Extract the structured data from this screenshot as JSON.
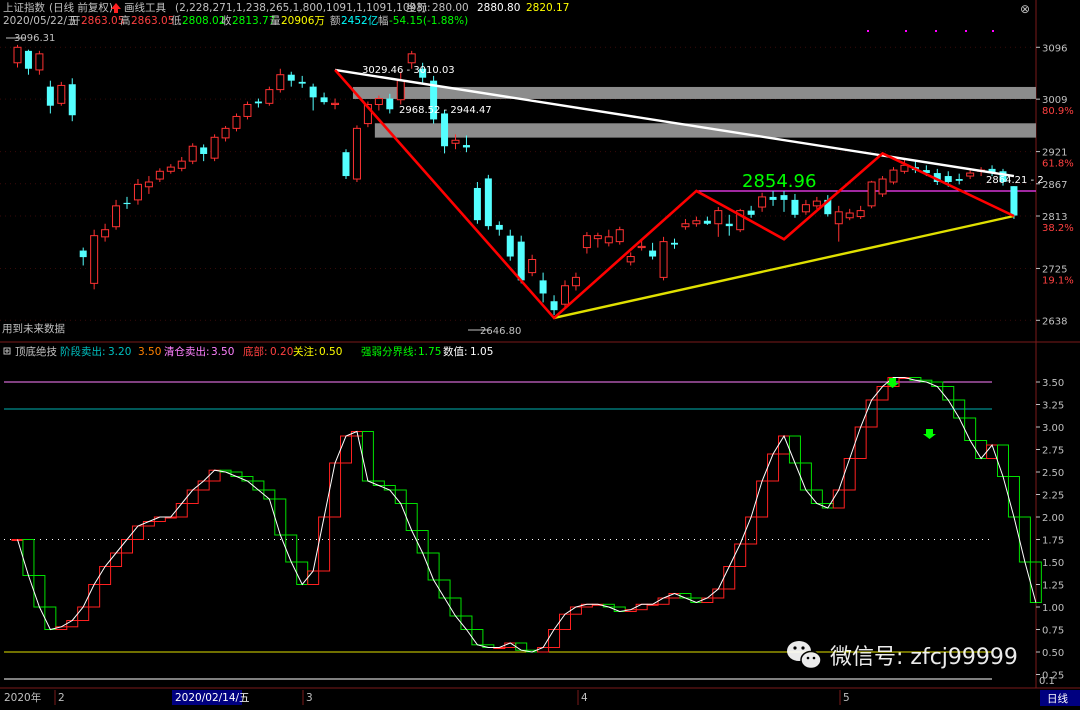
{
  "header": {
    "line1": {
      "index_name": "上证指数",
      "mode": "(日线 前复权)",
      "tool_icon": "up-arrow-icon",
      "tool_label": "画线工具",
      "tool_params": "(2,228,271,1,238,265,1,800,1091,1,1091,1093)",
      "coord_label": "坐标:",
      "coord_val": "280.00",
      "coord_val2": "2880.80",
      "coord_val3": "2820.17"
    },
    "line2": {
      "date": "2020/05/22/五",
      "open_label": "开",
      "open": "2863.05",
      "high_label": "高",
      "high": "2863.05",
      "low_label": "低",
      "low": "2808.02",
      "close_label": "收",
      "close": "2813.77",
      "vol_label": "量",
      "vol": "20906万",
      "amt_label": "额",
      "amt": "2452亿",
      "chg_label": "幅",
      "chg": "-54.15(-1.88%)"
    }
  },
  "price_axis": {
    "ticks": [
      {
        "value": "3096",
        "pct": ""
      },
      {
        "value": "3009",
        "pct": "80.9%"
      },
      {
        "value": "2921",
        "pct": "61.8%"
      },
      {
        "value": "2867",
        "pct": ""
      },
      {
        "value": "2813",
        "pct": "38.2%"
      },
      {
        "value": "2725",
        "pct": "19.1%"
      },
      {
        "value": "2638",
        "pct": ""
      }
    ]
  },
  "annotations": {
    "high_label": "3096.31",
    "zone1_label": "3029.46 - 3010.03",
    "zone2_label": "2968.52 - 2944.47",
    "low_label": "2646.80",
    "peak_label": "2854.96",
    "right_label": "2864.21 - 2",
    "future_note": "用到未来数据"
  },
  "indicator": {
    "name": "顶底绝技",
    "params": [
      {
        "label": "阶段卖出:",
        "value": "3.20",
        "extra": "3.50",
        "color": "#00c0c0"
      },
      {
        "label": "清仓卖出:",
        "value": "3.50",
        "extra": "",
        "color": "#ff80ff"
      },
      {
        "label": "底部:",
        "value": "0.20",
        "extra": "",
        "color": "#ff4040"
      },
      {
        "label": "关注:",
        "value": "0.50",
        "extra": "",
        "color": "#ffff00"
      },
      {
        "label": "强弱分界线:",
        "value": "1.75",
        "extra": "",
        "color": "#00ff00"
      },
      {
        "label": "数值:",
        "value": "1.05",
        "extra": "",
        "color": "#ffffff"
      }
    ],
    "axis_ticks": [
      "3.50",
      "3.25",
      "3.00",
      "2.75",
      "2.50",
      "2.25",
      "2.00",
      "1.75",
      "1.50",
      "1.25",
      "1.00",
      "0.75",
      "0.50",
      "0.25"
    ],
    "corner_value": "0.1"
  },
  "bottom_bar": {
    "year": "2020年",
    "month2": "2",
    "date_highlight": "2020/02/14/五",
    "month3": "3",
    "month4": "4",
    "month5": "5",
    "period": "日线"
  },
  "watermark": {
    "icon": "wechat-icon",
    "text": "微信号: zfcj99999"
  },
  "chart_data": [
    {
      "type": "candlestick",
      "title": "上证指数 日线",
      "ylim": [
        2610,
        3125
      ],
      "y_ticks": [
        3096,
        3009,
        2921,
        2867,
        2813,
        2725,
        2638
      ],
      "fib_levels": {
        "80.9%": 3009,
        "61.8%": 2921,
        "38.2%": 2813,
        "19.1%": 2725
      },
      "candles": [
        {
          "o": 3070,
          "c": 3096,
          "h": 3100,
          "l": 3062
        },
        {
          "o": 3090,
          "c": 3060,
          "h": 3092,
          "l": 3050
        },
        {
          "o": 3058,
          "c": 3085,
          "h": 3090,
          "l": 3050
        },
        {
          "o": 3030,
          "c": 2998,
          "h": 3040,
          "l": 2985
        },
        {
          "o": 3002,
          "c": 3032,
          "h": 3038,
          "l": 2998
        },
        {
          "o": 3034,
          "c": 2982,
          "h": 3044,
          "l": 2972
        },
        {
          "o": 2755,
          "c": 2744,
          "h": 2760,
          "l": 2730
        },
        {
          "o": 2700,
          "c": 2780,
          "h": 2790,
          "l": 2690
        },
        {
          "o": 2778,
          "c": 2790,
          "h": 2800,
          "l": 2770
        },
        {
          "o": 2795,
          "c": 2830,
          "h": 2840,
          "l": 2790
        },
        {
          "o": 2835,
          "c": 2833,
          "h": 2845,
          "l": 2825
        },
        {
          "o": 2840,
          "c": 2866,
          "h": 2875,
          "l": 2832
        },
        {
          "o": 2862,
          "c": 2870,
          "h": 2880,
          "l": 2850
        },
        {
          "o": 2875,
          "c": 2888,
          "h": 2893,
          "l": 2870
        },
        {
          "o": 2888,
          "c": 2895,
          "h": 2900,
          "l": 2884
        },
        {
          "o": 2893,
          "c": 2905,
          "h": 2912,
          "l": 2888
        },
        {
          "o": 2905,
          "c": 2930,
          "h": 2935,
          "l": 2900
        },
        {
          "o": 2928,
          "c": 2917,
          "h": 2933,
          "l": 2905
        },
        {
          "o": 2910,
          "c": 2945,
          "h": 2950,
          "l": 2905
        },
        {
          "o": 2944,
          "c": 2960,
          "h": 2964,
          "l": 2938
        },
        {
          "o": 2960,
          "c": 2980,
          "h": 2985,
          "l": 2955
        },
        {
          "o": 2980,
          "c": 3000,
          "h": 3005,
          "l": 2975
        },
        {
          "o": 3005,
          "c": 3002,
          "h": 3010,
          "l": 2995
        },
        {
          "o": 3002,
          "c": 3025,
          "h": 3030,
          "l": 2998
        },
        {
          "o": 3025,
          "c": 3050,
          "h": 3060,
          "l": 3020
        },
        {
          "o": 3050,
          "c": 3040,
          "h": 3055,
          "l": 3030
        },
        {
          "o": 3038,
          "c": 3035,
          "h": 3048,
          "l": 3028
        },
        {
          "o": 3030,
          "c": 3012,
          "h": 3035,
          "l": 2990
        },
        {
          "o": 3012,
          "c": 3004,
          "h": 3020,
          "l": 3000
        },
        {
          "o": 3000,
          "c": 3002,
          "h": 3010,
          "l": 2992
        },
        {
          "o": 2920,
          "c": 2880,
          "h": 2925,
          "l": 2875
        },
        {
          "o": 2875,
          "c": 2960,
          "h": 2965,
          "l": 2870
        },
        {
          "o": 2968,
          "c": 3000,
          "h": 3005,
          "l": 2962
        },
        {
          "o": 3000,
          "c": 3010,
          "h": 3015,
          "l": 2990
        },
        {
          "o": 3010,
          "c": 2992,
          "h": 3018,
          "l": 2985
        },
        {
          "o": 3008,
          "c": 3040,
          "h": 3055,
          "l": 3000
        },
        {
          "o": 3070,
          "c": 3085,
          "h": 3090,
          "l": 3060
        },
        {
          "o": 3060,
          "c": 3045,
          "h": 3070,
          "l": 3035
        },
        {
          "o": 3040,
          "c": 2975,
          "h": 3048,
          "l": 2968
        },
        {
          "o": 2985,
          "c": 2930,
          "h": 2990,
          "l": 2918
        },
        {
          "o": 2935,
          "c": 2940,
          "h": 2950,
          "l": 2925
        },
        {
          "o": 2932,
          "c": 2928,
          "h": 2948,
          "l": 2920
        },
        {
          "o": 2860,
          "c": 2806,
          "h": 2870,
          "l": 2800
        },
        {
          "o": 2876,
          "c": 2796,
          "h": 2882,
          "l": 2790
        },
        {
          "o": 2798,
          "c": 2790,
          "h": 2804,
          "l": 2780
        },
        {
          "o": 2780,
          "c": 2745,
          "h": 2790,
          "l": 2738
        },
        {
          "o": 2770,
          "c": 2705,
          "h": 2780,
          "l": 2700
        },
        {
          "o": 2718,
          "c": 2740,
          "h": 2748,
          "l": 2712
        },
        {
          "o": 2705,
          "c": 2683,
          "h": 2718,
          "l": 2668
        },
        {
          "o": 2670,
          "c": 2655,
          "h": 2680,
          "l": 2646.8
        },
        {
          "o": 2665,
          "c": 2696,
          "h": 2705,
          "l": 2660
        },
        {
          "o": 2696,
          "c": 2710,
          "h": 2718,
          "l": 2688
        },
        {
          "o": 2760,
          "c": 2780,
          "h": 2786,
          "l": 2750
        },
        {
          "o": 2775,
          "c": 2780,
          "h": 2785,
          "l": 2760
        },
        {
          "o": 2768,
          "c": 2778,
          "h": 2790,
          "l": 2762
        },
        {
          "o": 2770,
          "c": 2790,
          "h": 2795,
          "l": 2765
        },
        {
          "o": 2736,
          "c": 2745,
          "h": 2752,
          "l": 2730
        },
        {
          "o": 2760,
          "c": 2762,
          "h": 2772,
          "l": 2755
        },
        {
          "o": 2755,
          "c": 2745,
          "h": 2768,
          "l": 2740
        },
        {
          "o": 2710,
          "c": 2770,
          "h": 2778,
          "l": 2705
        },
        {
          "o": 2768,
          "c": 2765,
          "h": 2775,
          "l": 2758
        },
        {
          "o": 2795,
          "c": 2800,
          "h": 2808,
          "l": 2790
        },
        {
          "o": 2800,
          "c": 2805,
          "h": 2812,
          "l": 2795
        },
        {
          "o": 2805,
          "c": 2800,
          "h": 2812,
          "l": 2798
        },
        {
          "o": 2800,
          "c": 2822,
          "h": 2828,
          "l": 2778
        },
        {
          "o": 2800,
          "c": 2796,
          "h": 2815,
          "l": 2780
        },
        {
          "o": 2790,
          "c": 2822,
          "h": 2825,
          "l": 2786
        },
        {
          "o": 2822,
          "c": 2815,
          "h": 2830,
          "l": 2810
        },
        {
          "o": 2828,
          "c": 2845,
          "h": 2852,
          "l": 2820
        },
        {
          "o": 2845,
          "c": 2840,
          "h": 2855,
          "l": 2830
        },
        {
          "o": 2848,
          "c": 2840,
          "h": 2855,
          "l": 2820
        },
        {
          "o": 2840,
          "c": 2815,
          "h": 2850,
          "l": 2810
        },
        {
          "o": 2820,
          "c": 2832,
          "h": 2840,
          "l": 2815
        },
        {
          "o": 2830,
          "c": 2838,
          "h": 2845,
          "l": 2825
        },
        {
          "o": 2840,
          "c": 2816,
          "h": 2848,
          "l": 2812
        },
        {
          "o": 2800,
          "c": 2820,
          "h": 2830,
          "l": 2770
        },
        {
          "o": 2810,
          "c": 2818,
          "h": 2825,
          "l": 2806
        },
        {
          "o": 2812,
          "c": 2822,
          "h": 2830,
          "l": 2808
        },
        {
          "o": 2830,
          "c": 2870,
          "h": 2872,
          "l": 2826
        },
        {
          "o": 2850,
          "c": 2875,
          "h": 2880,
          "l": 2845
        },
        {
          "o": 2870,
          "c": 2890,
          "h": 2895,
          "l": 2866
        },
        {
          "o": 2888,
          "c": 2898,
          "h": 2910,
          "l": 2884
        },
        {
          "o": 2895,
          "c": 2890,
          "h": 2905,
          "l": 2885
        },
        {
          "o": 2890,
          "c": 2885,
          "h": 2898,
          "l": 2880
        },
        {
          "o": 2885,
          "c": 2870,
          "h": 2892,
          "l": 2865
        },
        {
          "o": 2880,
          "c": 2870,
          "h": 2888,
          "l": 2862
        },
        {
          "o": 2875,
          "c": 2872,
          "h": 2884,
          "l": 2866
        },
        {
          "o": 2880,
          "c": 2885,
          "h": 2892,
          "l": 2875
        },
        {
          "o": 2888,
          "c": 2890,
          "h": 2895,
          "l": 2880
        },
        {
          "o": 2892,
          "c": 2885,
          "h": 2898,
          "l": 2880
        },
        {
          "o": 2888,
          "c": 2870,
          "h": 2892,
          "l": 2864
        },
        {
          "o": 2863.05,
          "c": 2813.77,
          "h": 2863.05,
          "l": 2808.02
        }
      ],
      "trend_lines": [
        {
          "name": "白色下降趋势线",
          "color": "#ffffff",
          "from": {
            "i": 29,
            "v": 3058
          },
          "to": {
            "i": 91,
            "v": 2880
          }
        },
        {
          "name": "黄色上升趋势线",
          "color": "#e0e000",
          "from": {
            "i": 49,
            "v": 2642
          },
          "to": {
            "i": 91,
            "v": 2813
          }
        },
        {
          "name": "红色走势折线",
          "color": "#ff0000",
          "points": [
            [
              29,
              3058
            ],
            [
              49,
              2642
            ],
            [
              62,
              2855
            ],
            [
              70,
              2774
            ],
            [
              79,
              2918
            ],
            [
              91,
              2813
            ]
          ]
        }
      ],
      "zones": [
        {
          "label": "3029.46 - 3010.03",
          "low": 3010.03,
          "high": 3029.46,
          "from_i": 31
        },
        {
          "label": "2968.52 - 2944.47",
          "low": 2944.47,
          "high": 2968.52,
          "from_i": 33
        }
      ],
      "hlines": [
        {
          "value": 2854.96,
          "color": "#ff40ff",
          "from_i": 62
        }
      ]
    },
    {
      "type": "line",
      "title": "顶底绝技",
      "ylim": [
        0.1,
        3.8
      ],
      "reference_lines": {
        "清仓卖出": 3.5,
        "阶段卖出": 3.2,
        "强弱分界线": 1.75,
        "关注": 0.5,
        "底部": 0.2
      },
      "values": [
        1.75,
        1.35,
        1.0,
        0.75,
        0.78,
        0.85,
        1.0,
        1.25,
        1.45,
        1.6,
        1.75,
        1.9,
        1.95,
        2.0,
        2.0,
        2.15,
        2.3,
        2.4,
        2.52,
        2.5,
        2.45,
        2.4,
        2.3,
        2.2,
        1.8,
        1.5,
        1.25,
        1.4,
        2.0,
        2.6,
        2.9,
        2.95,
        2.4,
        2.35,
        2.3,
        2.15,
        1.85,
        1.6,
        1.3,
        1.1,
        0.9,
        0.75,
        0.58,
        0.55,
        0.55,
        0.6,
        0.52,
        0.5,
        0.55,
        0.75,
        0.92,
        1.0,
        1.03,
        1.03,
        1.0,
        0.95,
        0.97,
        1.03,
        1.03,
        1.1,
        1.15,
        1.1,
        1.05,
        1.1,
        1.2,
        1.45,
        1.7,
        2.0,
        2.4,
        2.7,
        2.9,
        2.6,
        2.3,
        2.15,
        2.1,
        2.3,
        2.65,
        3.0,
        3.3,
        3.45,
        3.55,
        3.55,
        3.52,
        3.5,
        3.45,
        3.3,
        3.1,
        2.85,
        2.65,
        2.8,
        2.45,
        2.0,
        1.5,
        1.05
      ]
    }
  ]
}
